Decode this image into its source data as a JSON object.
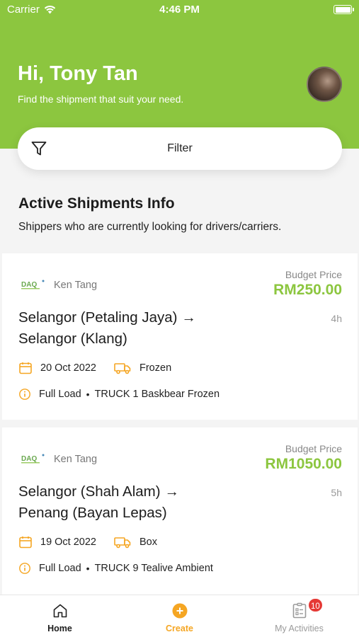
{
  "status_bar": {
    "carrier": "Carrier",
    "time": "4:46 PM"
  },
  "header": {
    "greeting": "Hi, Tony Tan",
    "subtitle": "Find the shipment that suit your need."
  },
  "filter": {
    "label": "Filter"
  },
  "section": {
    "title": "Active Shipments Info",
    "description": "Shippers who are currently looking for drivers/carriers."
  },
  "colors": {
    "accent": "#8cc63f",
    "warning": "#f5a623",
    "badge": "#e53935"
  },
  "shipments": [
    {
      "shipper": "Ken Tang",
      "budget_label": "Budget Price",
      "budget_price": "RM250.00",
      "route_from": "Selangor (Petaling Jaya)",
      "route_arrow": "→",
      "route_to": "Selangor (Klang)",
      "age": "4h",
      "date": "20 Oct 2022",
      "cargo_type": "Frozen",
      "load": "Full Load",
      "separator": "•",
      "truck": "TRUCK 1 Baskbear Frozen"
    },
    {
      "shipper": "Ken Tang",
      "budget_label": "Budget Price",
      "budget_price": "RM1050.00",
      "route_from": "Selangor (Shah Alam)",
      "route_arrow": "→",
      "route_to": "Penang (Bayan Lepas)",
      "age": "5h",
      "date": "19 Oct 2022",
      "cargo_type": "Box",
      "load": "Full Load",
      "separator": "•",
      "truck": "TRUCK 9 Tealive Ambient"
    }
  ],
  "tabbar": {
    "home": "Home",
    "create": "Create",
    "activities": "My Activities",
    "activities_badge": "10"
  }
}
